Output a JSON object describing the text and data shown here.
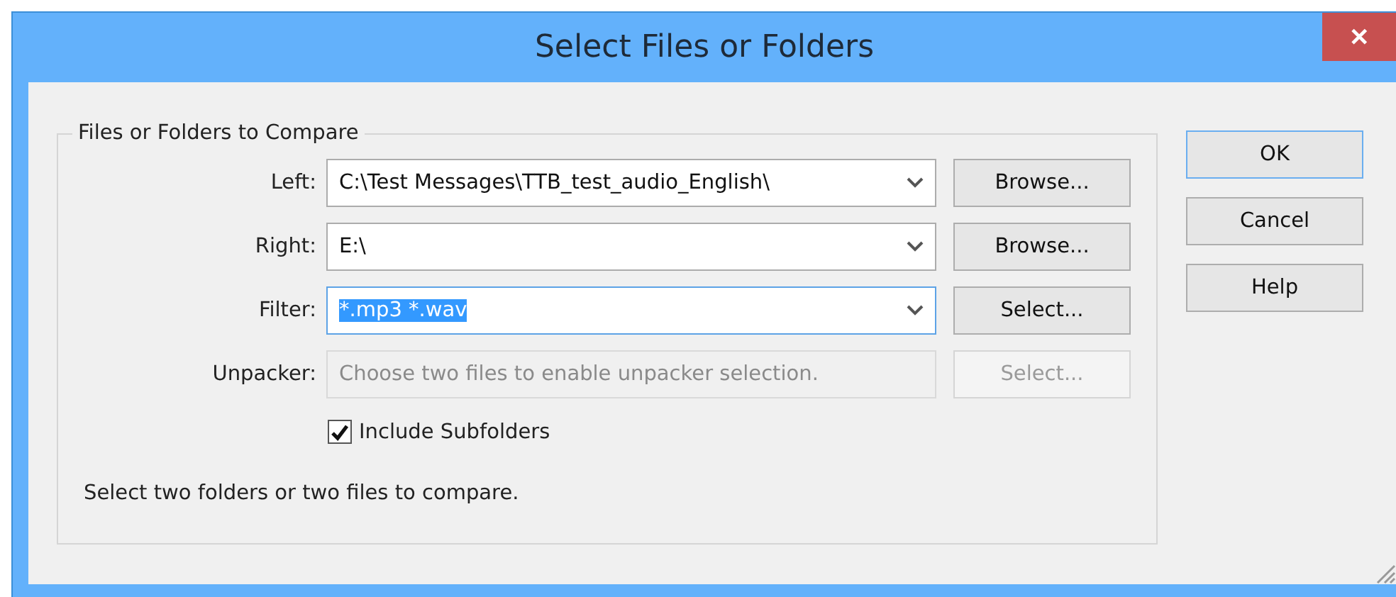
{
  "window": {
    "title": "Select Files or Folders",
    "close": "✕"
  },
  "group": {
    "title": "Files or Folders to Compare",
    "rows": [
      {
        "label": "Left:",
        "value": "C:\\Test Messages\\TTB_test_audio_English\\",
        "focused": false,
        "text_selected": false,
        "disabled": false,
        "dropdown": true,
        "button": {
          "label": "Browse...",
          "disabled": false
        }
      },
      {
        "label": "Right:",
        "value": "E:\\",
        "focused": false,
        "text_selected": false,
        "disabled": false,
        "dropdown": true,
        "button": {
          "label": "Browse...",
          "disabled": false
        }
      },
      {
        "label": "Filter:",
        "value": "*.mp3 *.wav",
        "focused": true,
        "text_selected": true,
        "disabled": false,
        "dropdown": true,
        "button": {
          "label": "Select...",
          "disabled": false
        }
      },
      {
        "label": "Unpacker:",
        "placeholder": "Choose two files to enable unpacker selection.",
        "focused": false,
        "text_selected": false,
        "disabled": true,
        "dropdown": false,
        "button": {
          "label": "Select...",
          "disabled": true
        }
      }
    ],
    "checkbox": {
      "label": "Include Subfolders",
      "checked": true
    },
    "status": "Select two folders or two files to compare."
  },
  "buttons": [
    {
      "label": "OK",
      "default": true
    },
    {
      "label": "Cancel",
      "default": false
    },
    {
      "label": "Help",
      "default": false
    }
  ]
}
